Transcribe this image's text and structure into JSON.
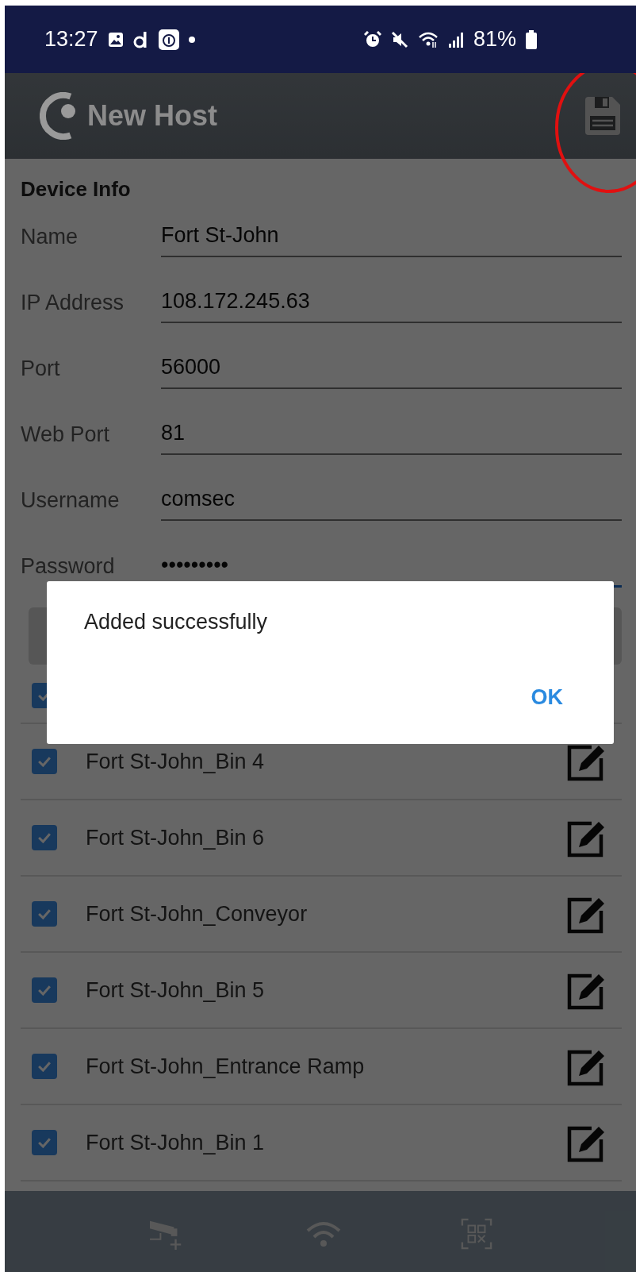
{
  "status_bar": {
    "time": "13:27",
    "battery": "81%"
  },
  "app_bar": {
    "title": "New Host"
  },
  "form": {
    "section": "Device Info",
    "fields": [
      {
        "label": "Name",
        "value": "Fort St-John",
        "focused": false
      },
      {
        "label": "IP Address",
        "value": "108.172.245.63",
        "focused": false
      },
      {
        "label": "Port",
        "value": "56000",
        "focused": false
      },
      {
        "label": "Web Port",
        "value": "81",
        "focused": false
      },
      {
        "label": "Username",
        "value": "comsec",
        "focused": false
      },
      {
        "label": "Password",
        "value": "•••••••••",
        "focused": true
      }
    ]
  },
  "cameras": [
    {
      "checked": true
    },
    {
      "name": "Fort St-John_Bin 4",
      "checked": true
    },
    {
      "name": "Fort St-John_Bin 6",
      "checked": true
    },
    {
      "name": "Fort St-John_Conveyor",
      "checked": true
    },
    {
      "name": "Fort St-John_Bin 5",
      "checked": true
    },
    {
      "name": "Fort St-John_Entrance Ramp",
      "checked": true
    },
    {
      "name": "Fort St-John_Bin 1",
      "checked": true
    }
  ],
  "dialog": {
    "message": "Added successfully",
    "buttons": [
      "OK"
    ]
  }
}
